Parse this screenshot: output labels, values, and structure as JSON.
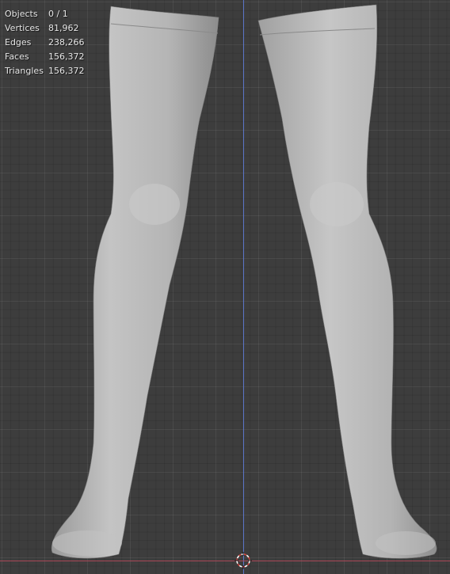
{
  "overlay": {
    "stats": [
      {
        "label": "Objects",
        "value": "0 / 1"
      },
      {
        "label": "Vertices",
        "value": "81,962"
      },
      {
        "label": "Edges",
        "value": "238,266"
      },
      {
        "label": "Faces",
        "value": "156,372"
      },
      {
        "label": "Triangles",
        "value": "156,372"
      }
    ]
  },
  "viewport": {
    "background_color": "#3d3d3d",
    "mesh_color": "#b7b7b7",
    "axis_x_color": "#b5485a",
    "axis_z_color": "#5e7bd6"
  },
  "icons": {
    "cursor": "3d-cursor-icon"
  }
}
